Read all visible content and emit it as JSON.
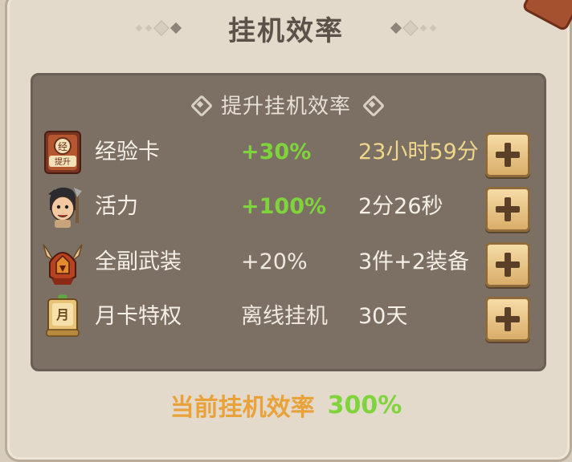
{
  "title": "挂机效率",
  "subtitle": "提升挂机效率",
  "rows": [
    {
      "icon": "exp-card-icon",
      "icon_text": "经",
      "icon_text2": "提升",
      "label": "经验卡",
      "value": "+30%",
      "detail": "23小时59分"
    },
    {
      "icon": "vitality-character-icon",
      "label": "活力",
      "value": "+100%",
      "detail": "2分26秒"
    },
    {
      "icon": "full-armor-helmet-icon",
      "label": "全副武装",
      "value": "+20%",
      "detail": "3件+2装备"
    },
    {
      "icon": "monthly-card-icon",
      "icon_text": "月",
      "label": "月卡特权",
      "value": "离线挂机",
      "detail": "30天"
    }
  ],
  "footer": {
    "label": "当前挂机效率",
    "value": "300%"
  },
  "colors": {
    "green": "#7fd43c",
    "gold": "#f0d78a",
    "orange": "#e9a13a",
    "panel": "#7c7065"
  }
}
